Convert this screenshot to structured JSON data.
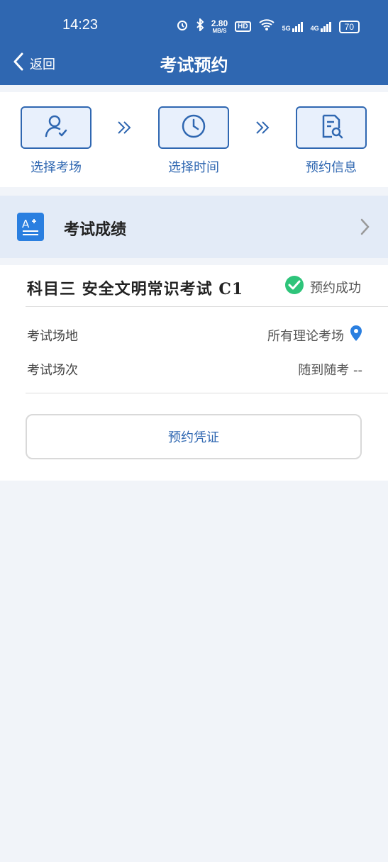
{
  "status_bar": {
    "time": "14:23",
    "speed": "2.80",
    "speed_unit": "MB/S",
    "hd": "HD",
    "net_5g": "5G",
    "net_4g": "4G",
    "battery": "70"
  },
  "app_bar": {
    "back_label": "返回",
    "title": "考试预约"
  },
  "steps": [
    {
      "label": "选择考场",
      "icon": "person-check-icon"
    },
    {
      "label": "选择时间",
      "icon": "clock-icon"
    },
    {
      "label": "预约信息",
      "icon": "document-search-icon"
    }
  ],
  "score_entry": {
    "title": "考试成绩",
    "icon": "score-icon"
  },
  "appointment": {
    "subject": "科目三 安全文明常识考试 C1",
    "status": "预约成功",
    "venue_label": "考试场地",
    "venue_value": "所有理论考场",
    "session_label": "考试场次",
    "session_value": "随到随考 --",
    "voucher_button": "预约凭证"
  },
  "colors": {
    "primary": "#2f67b1",
    "success": "#2ec47a",
    "score_icon_bg": "#2a7fe0"
  }
}
